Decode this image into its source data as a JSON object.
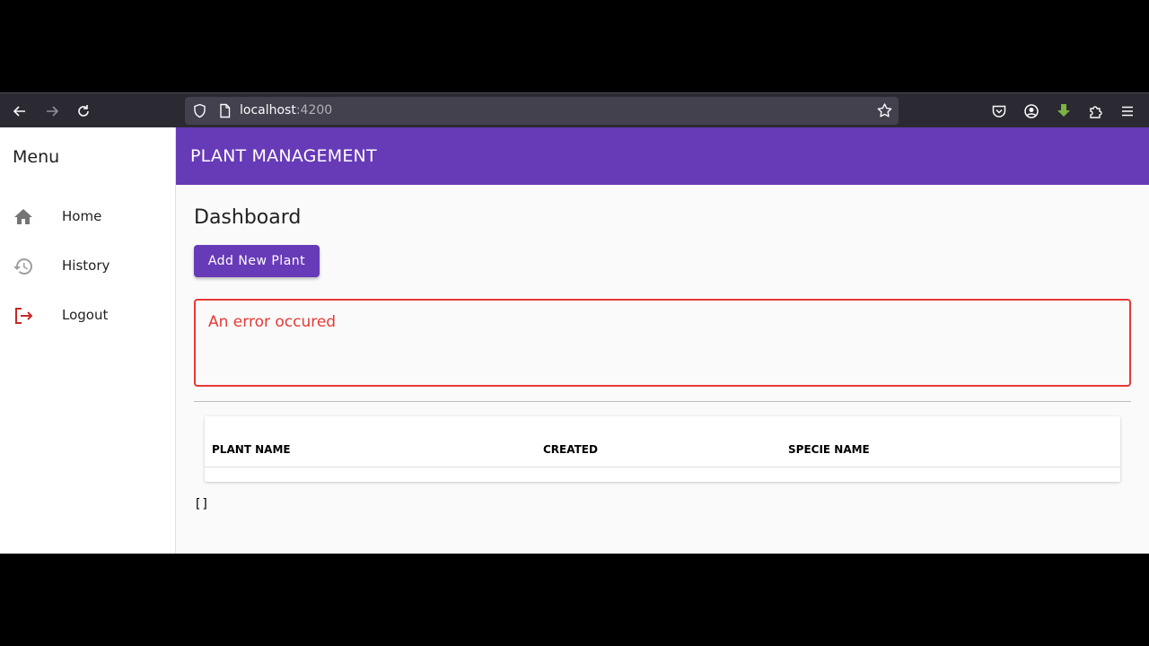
{
  "browser": {
    "url_host": "localhost",
    "url_port": ":4200",
    "icons": [
      "back-arrow-icon",
      "forward-arrow-icon",
      "reload-icon",
      "shield-icon",
      "page-icon",
      "star-icon",
      "pocket-icon",
      "account-icon",
      "download-icon",
      "extensions-icon",
      "hamburger-menu-icon"
    ]
  },
  "sidebar": {
    "title": "Menu",
    "items": [
      {
        "label": "Home",
        "icon": "home-icon"
      },
      {
        "label": "History",
        "icon": "history-icon"
      },
      {
        "label": "Logout",
        "icon": "logout-icon"
      }
    ]
  },
  "header": {
    "title": "PLANT MANAGEMENT"
  },
  "main": {
    "page_title": "Dashboard",
    "add_button_label": "Add New Plant",
    "error_message": "An error occured",
    "table": {
      "headers": [
        "PLANT NAME",
        "CREATED",
        "SPECIE NAME"
      ],
      "rows": []
    },
    "raw_output": "[]"
  },
  "colors": {
    "primary": "#673ab7",
    "error": "#e53935",
    "logout_icon": "#c62828"
  }
}
